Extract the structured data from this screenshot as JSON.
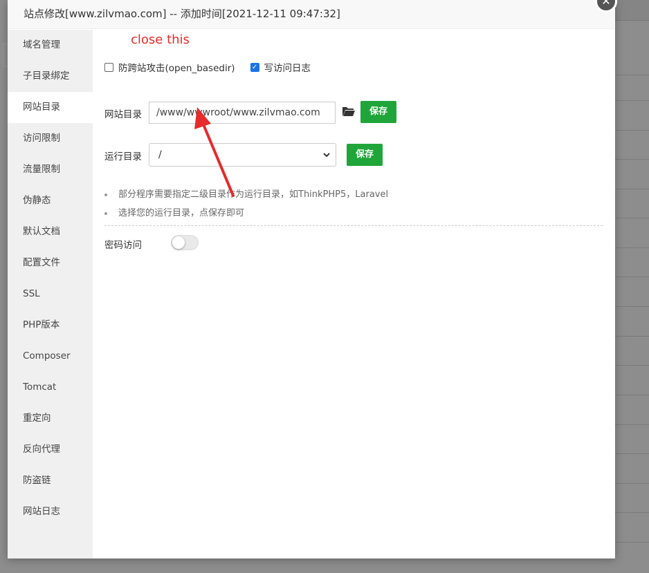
{
  "window": {
    "title": "站点修改[www.zilvmao.com] -- 添加时间[2021-12-11 09:47:32]",
    "close_glyph": "✕"
  },
  "sidebar": {
    "items": [
      {
        "label": "域名管理"
      },
      {
        "label": "子目录绑定"
      },
      {
        "label": "网站目录",
        "active": true
      },
      {
        "label": "访问限制"
      },
      {
        "label": "流量限制"
      },
      {
        "label": "伪静态"
      },
      {
        "label": "默认文档"
      },
      {
        "label": "配置文件"
      },
      {
        "label": "SSL"
      },
      {
        "label": "PHP版本"
      },
      {
        "label": "Composer"
      },
      {
        "label": "Tomcat"
      },
      {
        "label": "重定向"
      },
      {
        "label": "反向代理"
      },
      {
        "label": "防盗链"
      },
      {
        "label": "网站日志"
      }
    ]
  },
  "annotation": {
    "text": "close this",
    "color": "#e52b2b"
  },
  "options": {
    "open_basedir": {
      "label": "防跨站攻击(open_basedir)",
      "checked": false
    },
    "access_log": {
      "label": "写访问日志",
      "checked": true
    }
  },
  "site_dir": {
    "label": "网站目录",
    "value": "/www/wwwroot/www.zilvmao.com",
    "save_label": "保存",
    "folder_icon": "folder-open-icon"
  },
  "run_dir": {
    "label": "运行目录",
    "selected": "/",
    "save_label": "保存"
  },
  "tips": [
    "部分程序需要指定二级目录作为运行目录，如ThinkPHP5，Laravel",
    "选择您的运行目录，点保存即可"
  ],
  "password_access": {
    "label": "密码访问",
    "enabled": false
  },
  "colors": {
    "save_green": "#20a53a",
    "checkbox_blue": "#1a73e8"
  }
}
